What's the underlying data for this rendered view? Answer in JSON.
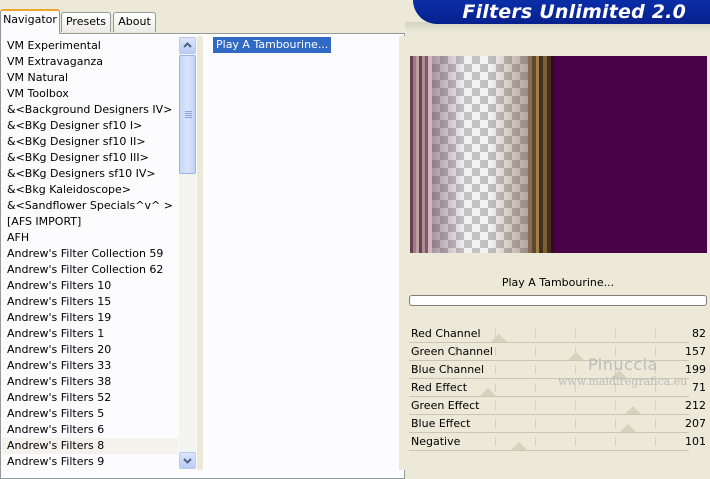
{
  "tabs": [
    {
      "label": "Navigator",
      "active": true
    },
    {
      "label": "Presets",
      "active": false
    },
    {
      "label": "About",
      "active": false
    }
  ],
  "header": {
    "title": "Filters Unlimited 2.0"
  },
  "filter_categories": [
    "VM Experimental",
    "VM Extravaganza",
    "VM Natural",
    "VM Toolbox",
    "&<Background Designers IV>",
    "&<BKg Designer sf10 I>",
    "&<BKg Designer sf10 II>",
    "&<BKg Designer sf10 III>",
    "&<BKg Designers sf10 IV>",
    "&<Bkg Kaleidoscope>",
    "&<Sandflower Specials^v^ >",
    "[AFS IMPORT]",
    "AFH",
    "Andrew's Filter Collection 59",
    "Andrew's Filter Collection 62",
    "Andrew's Filters 10",
    "Andrew's Filters 15",
    "Andrew's Filters 19",
    "Andrew's Filters 1",
    "Andrew's Filters 20",
    "Andrew's Filters 33",
    "Andrew's Filters 38",
    "Andrew's Filters 52",
    "Andrew's Filters 5",
    "Andrew's Filters 6",
    "Andrew's Filters 8",
    "Andrew's Filters 9"
  ],
  "selected_category": "Andrew's Filters 8",
  "effects": [
    "Play A Tambourine..."
  ],
  "selected_effect": "Play A Tambourine...",
  "preview": {
    "background_color": "#480046"
  },
  "effect_title": "Play A Tambourine...",
  "progress": 0,
  "parameters": [
    {
      "label": "Red Channel",
      "value": "82"
    },
    {
      "label": "Green Channel",
      "value": "157"
    },
    {
      "label": "Blue Channel",
      "value": "199"
    },
    {
      "label": "Red Effect",
      "value": "71"
    },
    {
      "label": "Green Effect",
      "value": "212"
    },
    {
      "label": "Blue Effect",
      "value": "207"
    },
    {
      "label": "Negative",
      "value": "101"
    }
  ],
  "watermark": {
    "line1": "Pinuccia",
    "line2": "www.maidiregrafica.eu"
  },
  "colors": {
    "accent": "#316ac5",
    "banner": "#0a2ea8",
    "tab_highlight": "#f0a52d"
  }
}
